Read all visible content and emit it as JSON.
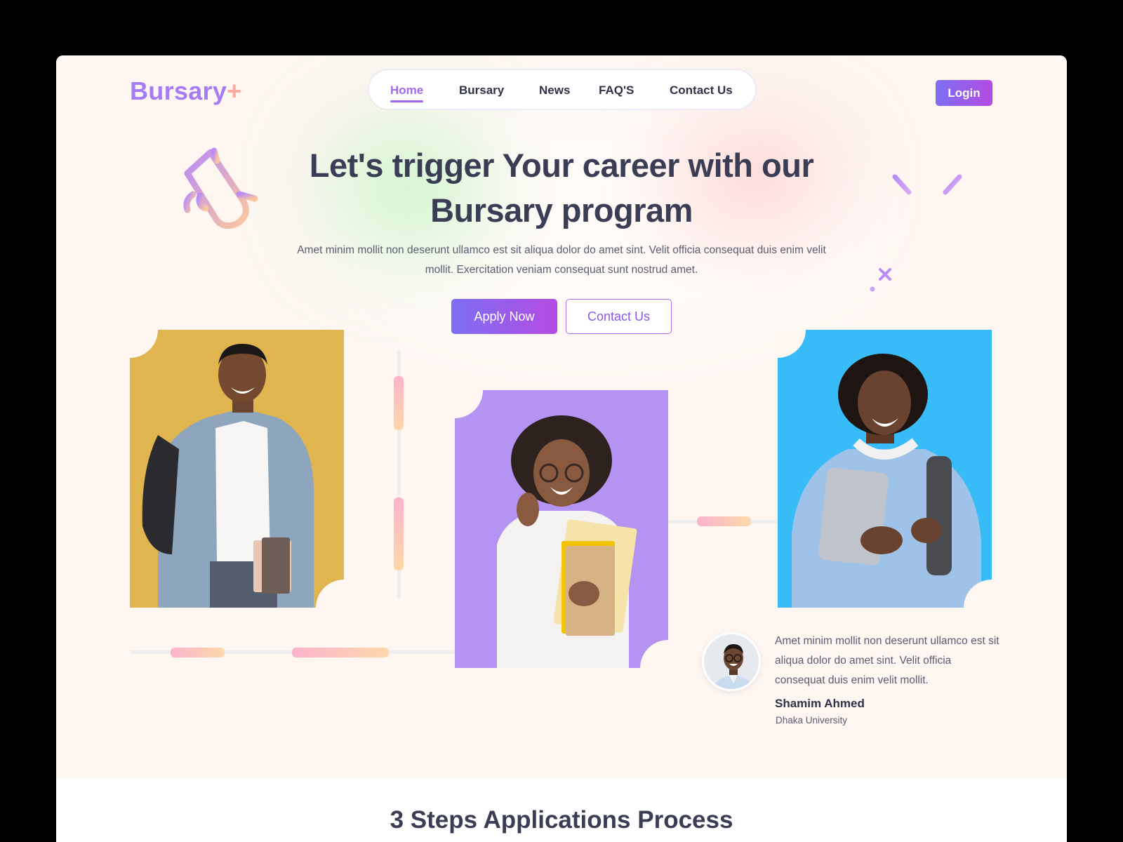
{
  "brand": {
    "name": "Bursary",
    "plus": "+"
  },
  "nav": {
    "items": [
      {
        "label": "Home",
        "active": true
      },
      {
        "label": "Bursary",
        "active": false
      },
      {
        "label": "News",
        "active": false
      },
      {
        "label": "FAQ'S",
        "active": false
      },
      {
        "label": "Contact Us",
        "active": false
      }
    ]
  },
  "header": {
    "login_label": "Login"
  },
  "hero": {
    "headline_line1": "Let's trigger Your career with our",
    "headline_line2": "Bursary program",
    "subtext": "Amet minim mollit non deserunt ullamco est sit aliqua dolor do amet sint. Velit officia consequat duis enim velit mollit. Exercitation veniam consequat sunt nostrud amet.",
    "apply_label": "Apply Now",
    "contact_label": "Contact Us"
  },
  "testimonial": {
    "quote": "Amet minim mollit non deserunt ullamco est sit aliqua dolor do amet sint. Velit officia consequat duis enim velit mollit.",
    "name": "Shamim Ahmed",
    "school": "Dhaka University"
  },
  "steps": {
    "title": "3 Steps Applications Process"
  },
  "colors": {
    "accent": "#a77bf3",
    "gradient_start": "#7d6ff3",
    "gradient_end": "#b44be2",
    "card_yellow": "#e0b44f",
    "card_purple": "#b493f2",
    "card_blue": "#38bcf7",
    "hero_bg": "#fdf6f1"
  },
  "icons": [
    "graduation-scroll-icon",
    "sparkle-lines-icon",
    "sparkle-x-icon"
  ]
}
